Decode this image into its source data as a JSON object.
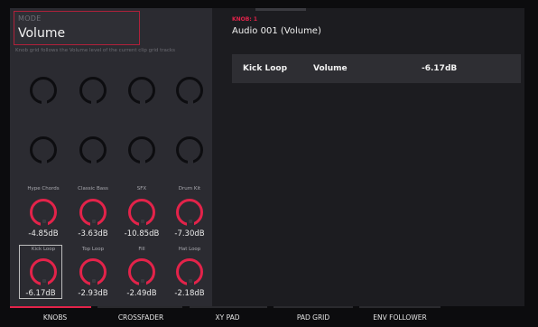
{
  "mode": {
    "label": "MODE",
    "value": "Volume",
    "description": "Knob grid follows the Volume level of the current clip grid tracks"
  },
  "knob_header": {
    "tag": "KNOB: 1",
    "title": "Audio 001 (Volume)"
  },
  "info_row": {
    "track": "Kick Loop",
    "parameter": "Volume",
    "value": "-6.17dB"
  },
  "active_knobs": [
    {
      "name": "Hype Chords",
      "value": "-4.85dB"
    },
    {
      "name": "Classic Bass",
      "value": "-3.63dB"
    },
    {
      "name": "SFX",
      "value": "-10.85dB"
    },
    {
      "name": "Drum Kit",
      "value": "-7.30dB"
    },
    {
      "name": "Kick Loop",
      "value": "-6.17dB"
    },
    {
      "name": "Top Loop",
      "value": "-2.93dB"
    },
    {
      "name": "Fill",
      "value": "-2.49dB"
    },
    {
      "name": "Hat Loop",
      "value": "-2.18dB"
    }
  ],
  "selected_knob": "Kick Loop",
  "tabs": [
    {
      "label": "KNOBS",
      "active": true
    },
    {
      "label": "CROSSFADER",
      "active": false
    },
    {
      "label": "XY PAD",
      "active": false
    },
    {
      "label": "PAD GRID",
      "active": false
    },
    {
      "label": "ENV FOLLOWER",
      "active": false
    }
  ],
  "colors": {
    "accent": "#e3234a",
    "panel": "#2b2b31",
    "background": "#1d1d21"
  }
}
